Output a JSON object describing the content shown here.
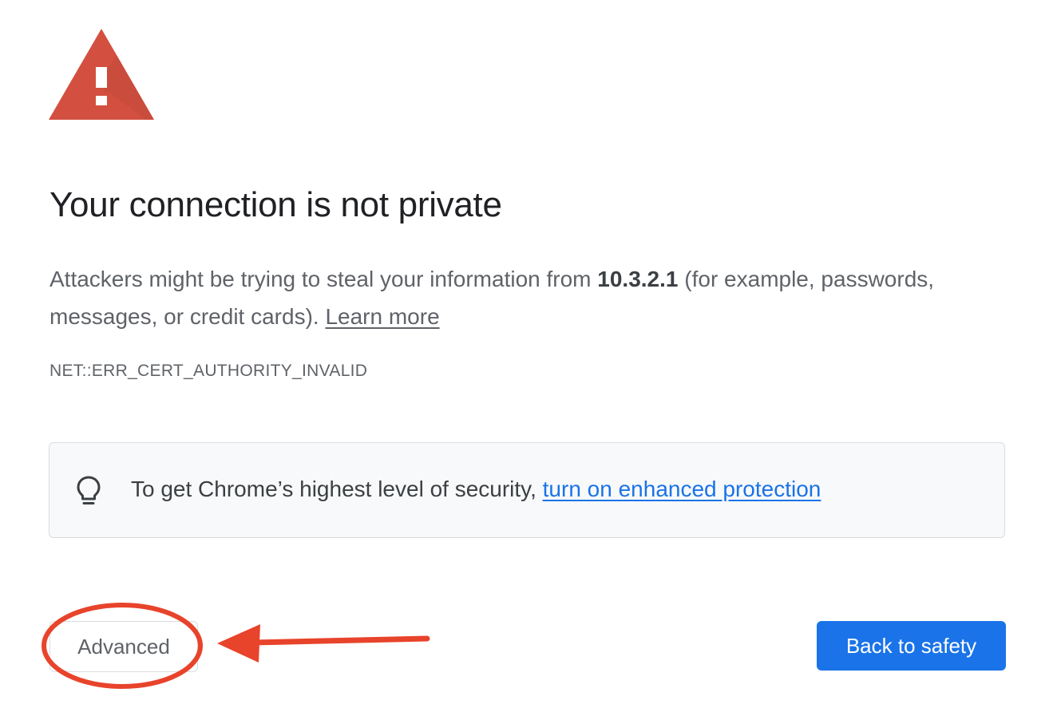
{
  "colors": {
    "warning_red": "#d34f3f",
    "warning_red_shadow": "#b84435",
    "link_blue": "#1a73e8",
    "primary_button": "#1a73e8",
    "annotation_red": "#e8432b"
  },
  "icons": {
    "warning": "warning-triangle-icon",
    "bulb": "lightbulb-icon",
    "arrow": "annotation-arrow",
    "circle": "annotation-circle"
  },
  "interstitial": {
    "title": "Your connection is not private",
    "description": {
      "prefix": "Attackers might be trying to steal your information from ",
      "host": "10.3.2.1",
      "suffix": " (for example, passwords, messages, or credit cards). ",
      "learn_more": "Learn more"
    },
    "error_code": "NET::ERR_CERT_AUTHORITY_INVALID",
    "enhanced_protection": {
      "text": "To get Chrome’s highest level of security, ",
      "link": "turn on enhanced protection"
    },
    "buttons": {
      "advanced": "Advanced",
      "back_to_safety": "Back to safety"
    }
  }
}
